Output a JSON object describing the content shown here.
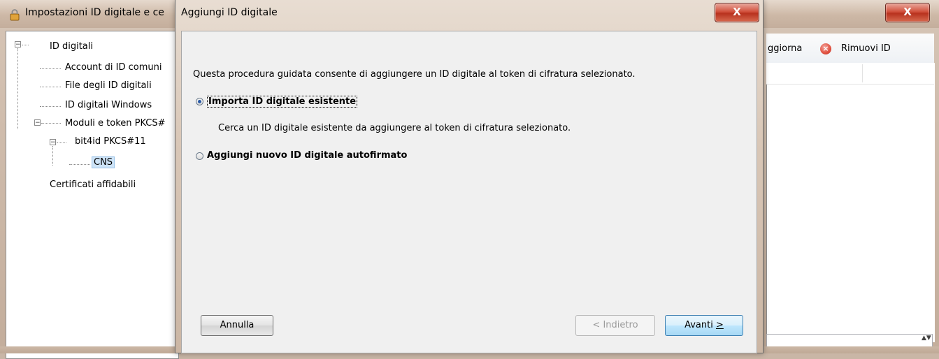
{
  "background_window": {
    "title": "Impostazioni ID digitale e ce",
    "close_label": "X",
    "tree": {
      "root": "ID digitali",
      "children": [
        "Account di ID comuni",
        "File degli ID digitali",
        "ID digitali Windows",
        "Moduli e token PKCS#"
      ],
      "module": "bit4id PKCS#11",
      "selected": "CNS",
      "trusted": "Certificati affidabili"
    },
    "toolbar": {
      "refresh_label": "ggiorna",
      "remove_label": "Rimuovi ID",
      "remove_icon": "remove-icon"
    },
    "spinner_glyph": "▲▼"
  },
  "dialog": {
    "title": "Aggiungi ID digitale",
    "close_label": "X",
    "intro": "Questa procedura guidata consente di aggiungere un ID digitale al token di cifratura selezionato.",
    "options": [
      {
        "label": "Importa ID digitale esistente",
        "checked": true
      },
      {
        "label": "Aggiungi nuovo ID digitale autofirmato",
        "checked": false
      }
    ],
    "option1_description": "Cerca un ID digitale esistente da aggiungere al token di cifratura selezionato.",
    "buttons": {
      "cancel": "Annulla",
      "back": "< Indietro",
      "next_prefix": "Avanti ",
      "next_accel": ">"
    }
  }
}
